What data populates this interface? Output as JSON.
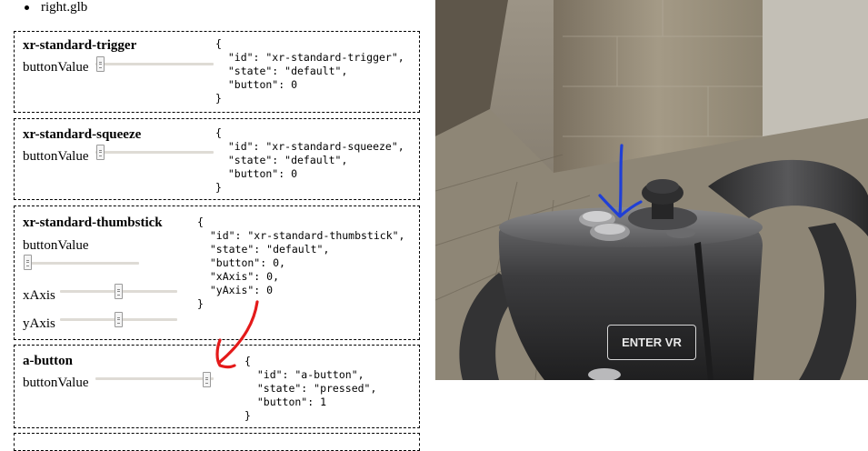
{
  "file_list": [
    "right.glb"
  ],
  "components": [
    {
      "title": "xr-standard-trigger",
      "button_value_label": "buttonValue",
      "button_value": 0,
      "json_text": "{\n  \"id\": \"xr-standard-trigger\",\n  \"state\": \"default\",\n  \"button\": 0\n}"
    },
    {
      "title": "xr-standard-squeeze",
      "button_value_label": "buttonValue",
      "button_value": 0,
      "json_text": "{\n  \"id\": \"xr-standard-squeeze\",\n  \"state\": \"default\",\n  \"button\": 0\n}"
    },
    {
      "title": "xr-standard-thumbstick",
      "button_value_label": "buttonValue",
      "button_value": 0,
      "x_axis_label": "xAxis",
      "y_axis_label": "yAxis",
      "x_axis": 0,
      "y_axis": 0,
      "json_text": "{\n  \"id\": \"xr-standard-thumbstick\",\n  \"state\": \"default\",\n  \"button\": 0,\n  \"xAxis\": 0,\n  \"yAxis\": 0\n}"
    },
    {
      "title": "a-button",
      "button_value_label": "buttonValue",
      "button_value": 1,
      "json_text": "{\n  \"id\": \"a-button\",\n  \"state\": \"pressed\",\n  \"button\": 1\n}"
    }
  ],
  "enter_vr_label": "ENTER VR",
  "annotation_colors": {
    "red_arrow": "#e41a1a",
    "blue_arrow": "#1f3fd6"
  }
}
